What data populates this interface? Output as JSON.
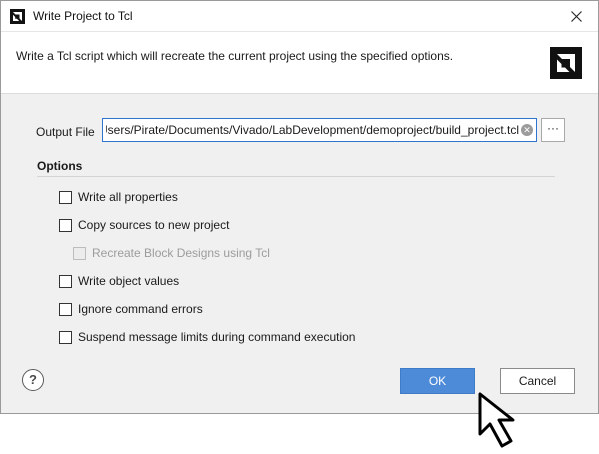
{
  "window": {
    "title": "Write Project to Tcl",
    "close_glyph": "✕",
    "logo_icon": "amd-logo-icon"
  },
  "header": {
    "description": "Write a Tcl script which will recreate the current project using the specified options.",
    "logo_icon": "amd-logo-icon"
  },
  "output_file": {
    "label": "Output File",
    "value": "C:/Users/Pirate/Documents/Vivado/LabDevelopment/demoproject/build_project.tcl",
    "clear_glyph": "✕",
    "browse_label": "···"
  },
  "options": {
    "heading": "Options",
    "items": [
      {
        "label": "Write all properties",
        "checked": false,
        "enabled": true
      },
      {
        "label": "Copy sources to new project",
        "checked": false,
        "enabled": true
      },
      {
        "label": "Recreate Block Designs using Tcl",
        "checked": false,
        "enabled": false
      },
      {
        "label": "Write object values",
        "checked": false,
        "enabled": true
      },
      {
        "label": "Ignore command errors",
        "checked": false,
        "enabled": true
      },
      {
        "label": "Suspend message limits during command execution",
        "checked": false,
        "enabled": true
      }
    ]
  },
  "footer": {
    "help_glyph": "?",
    "ok_label": "OK",
    "cancel_label": "Cancel"
  },
  "colors": {
    "accent": "#4d8ad8",
    "focus_border": "#2e74d1",
    "body_background": "#f0f0f0"
  },
  "cursor_icon": "mouse-pointer-icon"
}
